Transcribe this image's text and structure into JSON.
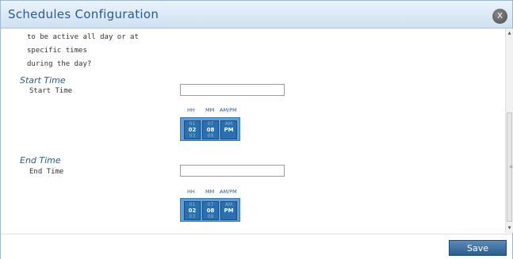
{
  "dialog": {
    "title": "Schedules Configuration",
    "close_label": "X",
    "save_label": "Save"
  },
  "description_lines": [
    "to be active all day or at",
    "specific times",
    "during the day?"
  ],
  "start_time": {
    "section_title": "Start Time",
    "field_label": "Start Time",
    "value": "",
    "picker": {
      "headers": [
        "HH",
        "MM",
        "AM/PM"
      ],
      "hour": {
        "prev": "01",
        "current": "02",
        "next": "03"
      },
      "minute": {
        "prev": "07",
        "current": "08",
        "next": "09"
      },
      "ampm": {
        "prev": "AM",
        "current": "PM",
        "next": ""
      }
    }
  },
  "end_time": {
    "section_title": "End Time",
    "field_label": "End Time",
    "value": "",
    "picker": {
      "headers": [
        "HH",
        "MM",
        "AM/PM"
      ],
      "hour": {
        "prev": "01",
        "current": "02",
        "next": "03"
      },
      "minute": {
        "prev": "07",
        "current": "08",
        "next": "09"
      },
      "ampm": {
        "prev": "AM",
        "current": "PM",
        "next": ""
      }
    }
  },
  "colors": {
    "title": "#2a5b8c",
    "picker_bg": "#5f9fd6",
    "wheel_bg": "#2a6fb0",
    "save_button": "#2c5d8f"
  }
}
